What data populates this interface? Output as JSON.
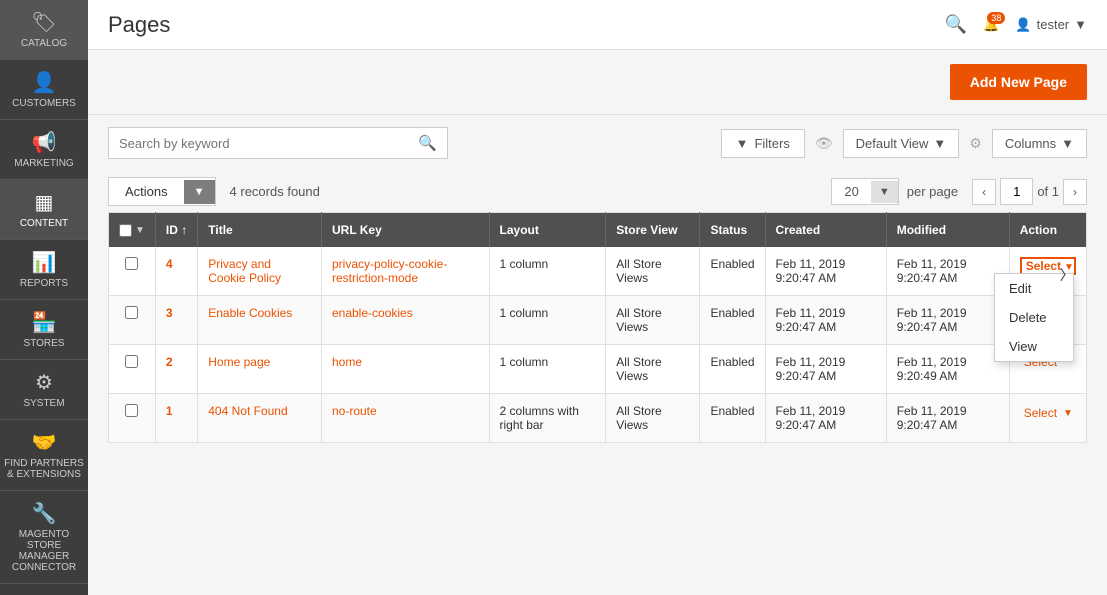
{
  "sidebar": {
    "items": [
      {
        "label": "CATALOG",
        "icon": "🏷",
        "active": false
      },
      {
        "label": "CUSTOMERS",
        "icon": "👤",
        "active": false
      },
      {
        "label": "MARKETING",
        "icon": "📢",
        "active": false
      },
      {
        "label": "CONTENT",
        "icon": "▦",
        "active": true
      },
      {
        "label": "REPORTS",
        "icon": "📊",
        "active": false
      },
      {
        "label": "STORES",
        "icon": "🏪",
        "active": false
      },
      {
        "label": "SYSTEM",
        "icon": "⚙",
        "active": false
      },
      {
        "label": "FIND PARTNERS & EXTENSIONS",
        "icon": "🤝",
        "active": false
      },
      {
        "label": "MAGENTO STORE MANAGER CONNECTOR",
        "icon": "🔧",
        "active": false
      }
    ]
  },
  "topbar": {
    "title": "Pages",
    "notif_count": "38",
    "user": "tester"
  },
  "toolbar": {
    "add_new_label": "Add New Page",
    "search_placeholder": "Search by keyword",
    "filters_label": "Filters",
    "default_view_label": "Default View",
    "columns_label": "Columns",
    "actions_label": "Actions",
    "records_found": "4 records found",
    "per_page": "20",
    "per_page_label": "per page",
    "page_num": "1",
    "page_of": "of 1"
  },
  "table": {
    "headers": [
      "",
      "ID ↑",
      "Title",
      "URL Key",
      "Layout",
      "Store View",
      "Status",
      "Created",
      "Modified",
      "Action"
    ],
    "rows": [
      {
        "id": "4",
        "title": "Privacy and Cookie Policy",
        "url_key": "privacy-policy-cookie-restriction-mode",
        "layout": "1 column",
        "store_view": "All Store Views",
        "status": "Enabled",
        "created": "Feb 11, 2019 9:20:47 AM",
        "modified": "Feb 11, 2019 9:20:47 AM",
        "action": "Select",
        "dropdown_open": true
      },
      {
        "id": "3",
        "title": "Enable Cookies",
        "url_key": "enable-cookies",
        "layout": "1 column",
        "store_view": "All Store Views",
        "status": "Enabled",
        "created": "Feb 11, 2019 9:20:47 AM",
        "modified": "Feb 11, 2019 9:20:47 AM",
        "action": "Select",
        "dropdown_open": false
      },
      {
        "id": "2",
        "title": "Home page",
        "url_key": "home",
        "layout": "1 column",
        "store_view": "All Store Views",
        "status": "Enabled",
        "created": "Feb 11, 2019 9:20:47 AM",
        "modified": "Feb 11, 2019 9:20:49 AM",
        "action": "Select",
        "dropdown_open": false
      },
      {
        "id": "1",
        "title": "404 Not Found",
        "url_key": "no-route",
        "layout": "2 columns with right bar",
        "store_view": "All Store Views",
        "status": "Enabled",
        "created": "Feb 11, 2019 9:20:47 AM",
        "modified": "Feb 11, 2019 9:20:47 AM",
        "action": "Select",
        "dropdown_open": false
      }
    ],
    "dropdown_menu": [
      "Edit",
      "Delete",
      "View"
    ]
  }
}
